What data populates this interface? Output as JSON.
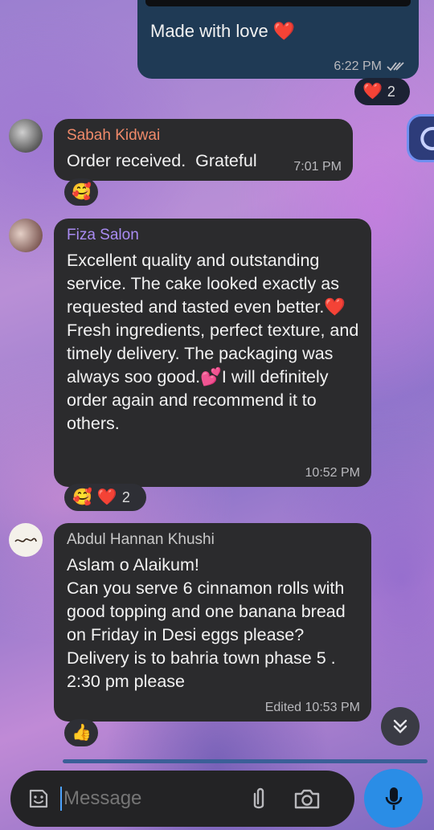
{
  "messages": [
    {
      "id": "m0",
      "direction": "outgoing",
      "text": "Made with love ❤️",
      "time": "6:22 PM",
      "status": "read-double-check",
      "reactions": {
        "emoji": "❤️",
        "count": "2"
      }
    },
    {
      "id": "m1",
      "sender": "Sabah Kidwai",
      "sender_color": "#f08a6a",
      "text": "Order received.  Grateful",
      "time": "7:01 PM",
      "reactions": {
        "emoji": "🥰"
      }
    },
    {
      "id": "m2",
      "sender": "Fiza Salon",
      "sender_color": "#a98bf2",
      "text": "Excellent quality and outstanding service. The cake looked exactly as requested and tasted even better.❤️ Fresh ingredients, perfect texture, and timely delivery. The packaging was always soo good.💕I will definitely order again and recommend it to others.",
      "time": "10:52 PM",
      "reactions": {
        "emoji1": "🥰",
        "emoji2": "❤️",
        "count": "2"
      }
    },
    {
      "id": "m3",
      "sender": "Abdul Hannan Khushi",
      "sender_color": "#c9c9c9",
      "text": "Aslam o Alaikum!\nCan you serve 6 cinnamon rolls with good topping and one banana bread on Friday in Desi eggs please? Delivery is to bahria town phase 5 . 2:30 pm please",
      "time": "Edited 10:53 PM",
      "reactions": {
        "emoji": "👍"
      }
    }
  ],
  "composer": {
    "placeholder": "Message"
  },
  "icons": {
    "emoji": "sticker-smile-icon",
    "attach": "paperclip-icon",
    "camera": "camera-icon",
    "mic": "microphone-icon",
    "scroll": "chevron-double-down-icon"
  },
  "colors": {
    "accent": "#2a8de6",
    "bubble_in": "#2b2b2d",
    "bubble_out": "#1f3a55"
  }
}
